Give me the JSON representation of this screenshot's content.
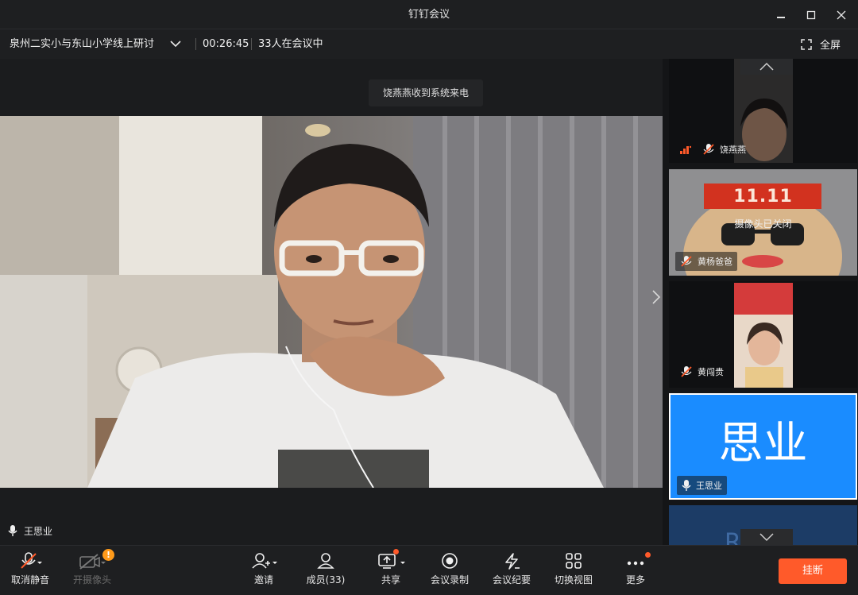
{
  "window": {
    "title": "钉钉会议"
  },
  "meeting": {
    "name": "泉州二实小与东山小学线上研讨",
    "elapsed": "00:26:45",
    "participants_text": "33人在会议中",
    "fullscreen_label": "全屏"
  },
  "toast": {
    "text": "饶燕燕收到系统来电"
  },
  "main_speaker": {
    "name": "王思业"
  },
  "sidebar": {
    "tiles": [
      {
        "name": "饶燕燕"
      },
      {
        "name": "黄杨爸爸",
        "overlay_big": "11.11",
        "camera_status": "摄像头已关闭"
      },
      {
        "name": "黄闯贵"
      },
      {
        "name": "王思业",
        "avatar_text": "思业"
      }
    ],
    "partial_tile_text": "R H"
  },
  "toolbar": {
    "mute": "取消静音",
    "camera": "开摄像头",
    "camera_badge": "!",
    "invite": "邀请",
    "members": "成员(33)",
    "share": "共享",
    "record": "会议录制",
    "minutes": "会议纪要",
    "switch_view": "切换视图",
    "more": "更多",
    "hangup": "挂断"
  },
  "colors": {
    "accent_orange": "#ff5a2a",
    "active_blue": "#1a8cff"
  }
}
